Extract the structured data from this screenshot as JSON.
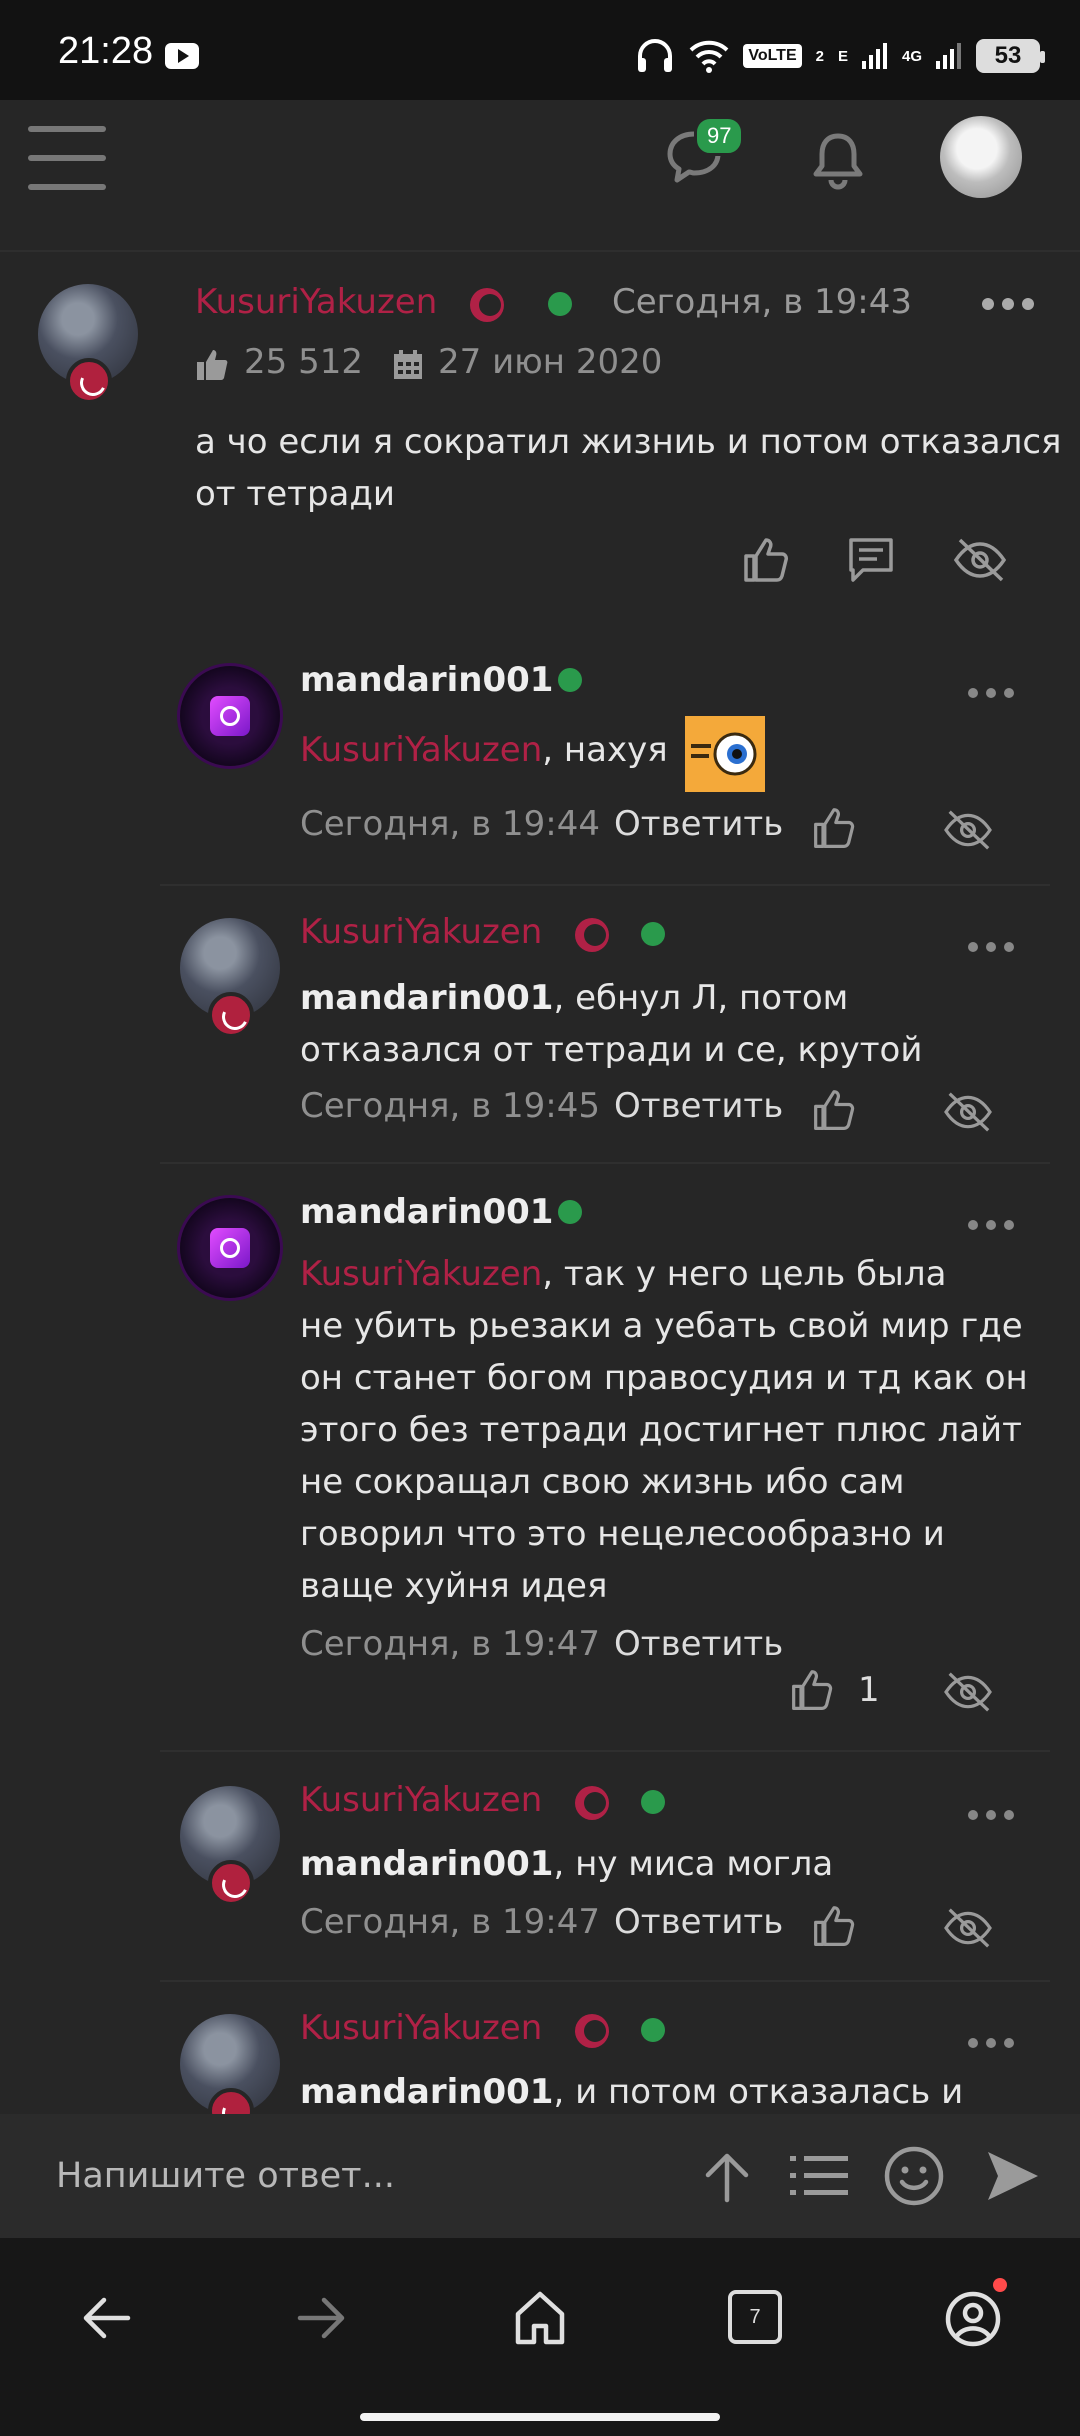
{
  "status_bar": {
    "time": "21:28",
    "volte": "VoLTE",
    "volte_sub": "2",
    "net_e": "E",
    "net_4g": "4G",
    "battery": "53"
  },
  "topbar": {
    "messages_badge": "97"
  },
  "colors": {
    "background": "#262626",
    "username_accent": "#b02146",
    "online": "#2a9a4c"
  },
  "post": {
    "author": "KusuriYakuzen",
    "date": "Сегодня, в 19:43",
    "likes": "25 512",
    "joined": "27 июн 2020",
    "text_line1": "а чо если я сократил жизниь и потом отказался",
    "text_line2": "от тетради"
  },
  "replies": [
    {
      "author": "mandarin001",
      "ref": "KusuriYakuzen",
      "text": ", нахуя",
      "date": "Сегодня, в 19:44",
      "reply_label": "Ответить"
    },
    {
      "author": "KusuriYakuzen",
      "ref": "mandarin001",
      "text_line1": ", ебнул Л, потом",
      "text_line2": "отказался от тетради и се, крутой",
      "date": "Сегодня, в 19:45",
      "reply_label": "Ответить"
    },
    {
      "author": "mandarin001",
      "ref": "KusuriYakuzen",
      "text_line1": ", так у него цель была",
      "text_line2": "не убить рьезаки а уебать свой мир где",
      "text_line3": "он станет богом правосудия и тд как он",
      "text_line4": "этого без тетради достигнет плюс лайт",
      "text_line5": "не сокращал свою жизнь ибо сам",
      "text_line6": "говорил что это нецелесообразно и",
      "text_line7": "ваще хуйня идея",
      "date": "Сегодня, в 19:47",
      "reply_label": "Ответить",
      "likes": "1"
    },
    {
      "author": "KusuriYakuzen",
      "ref": "mandarin001",
      "text": ", ну миса могла",
      "date": "Сегодня, в 19:47",
      "reply_label": "Ответить"
    },
    {
      "author": "KusuriYakuzen",
      "ref": "mandarin001",
      "text": ", и потом отказалась и"
    }
  ],
  "composer": {
    "placeholder": "Напишите ответ..."
  },
  "navbar": {
    "tabs_count": "7"
  }
}
